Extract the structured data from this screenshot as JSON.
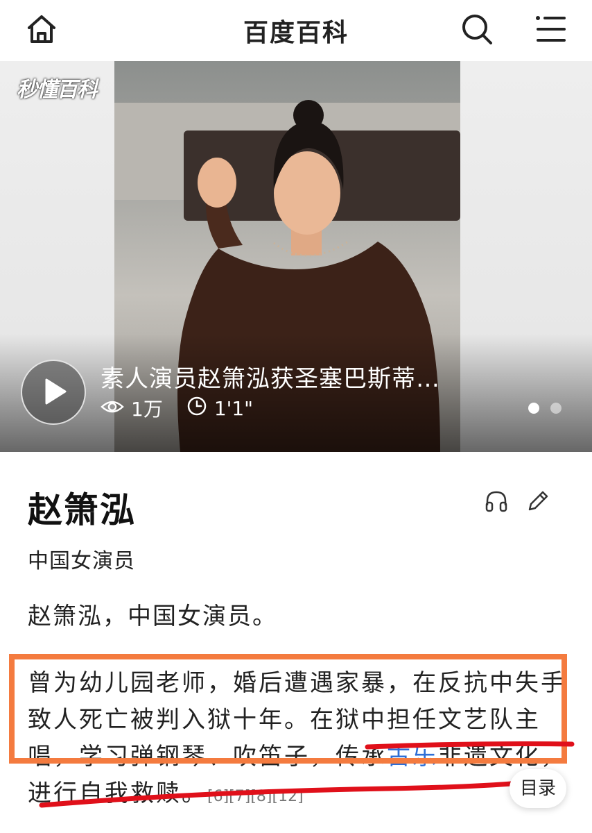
{
  "app": {
    "title": "百度百科"
  },
  "hero": {
    "watermark": "秒懂百科",
    "video_title": "素人演员赵箫泓获圣塞巴斯蒂…",
    "views": "1万",
    "duration": "1'1\"",
    "slide_count": 2,
    "active_slide": 1
  },
  "article": {
    "name": "赵箫泓",
    "subtitle": "中国女演员",
    "summary": "赵箫泓，中国女演员。",
    "para_text_1": "曾为幼儿园老师，婚后遭遇家暴，在反抗中失手致人死亡被判入狱十年。在狱中担任文艺队主唱，学习弹钢琴、吹笛子，传承",
    "para_link_1": "古乐",
    "para_text_2": "非遗文化，进行自我救赎。",
    "refs": "[6][7][8][12]"
  },
  "toc_button": "目录",
  "colors": {
    "highlight_box": "#f47b3f",
    "underline": "#e0101a",
    "link": "#2e6fd6"
  },
  "icons": [
    "home-icon",
    "search-icon",
    "menu-icon",
    "play-icon",
    "eye-icon",
    "clock-icon",
    "headphones-icon",
    "pencil-icon"
  ]
}
